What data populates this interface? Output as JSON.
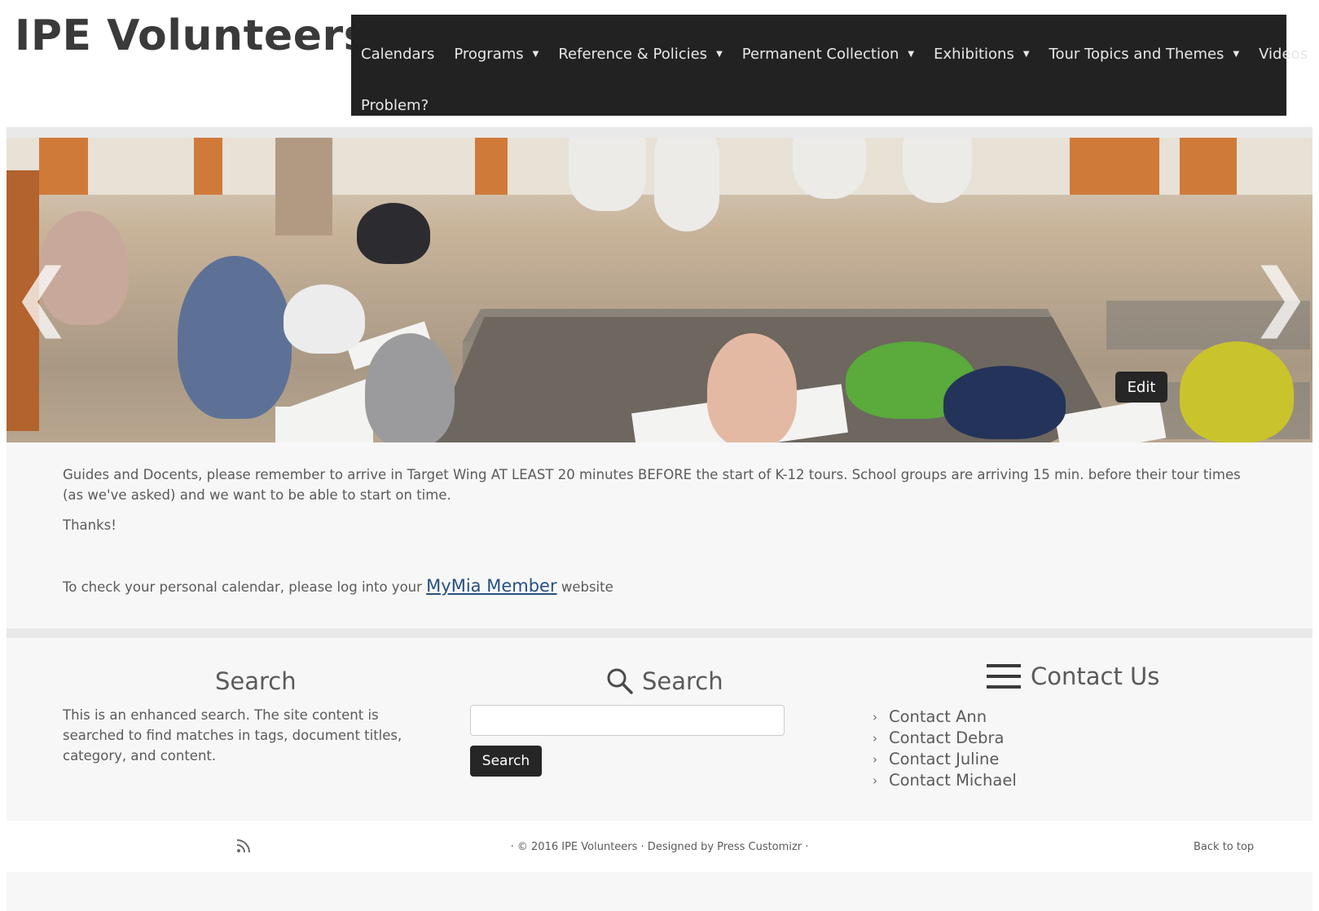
{
  "header": {
    "site_title": "IPE Volunteers",
    "nav": [
      {
        "label": "Calendars",
        "dropdown": false
      },
      {
        "label": "Programs",
        "dropdown": true
      },
      {
        "label": "Reference & Policies",
        "dropdown": true
      },
      {
        "label": "Permanent Collection",
        "dropdown": true
      },
      {
        "label": "Exhibitions",
        "dropdown": true
      },
      {
        "label": "Tour Topics and Themes",
        "dropdown": true
      },
      {
        "label": "Videos",
        "dropdown": false
      },
      {
        "label": "Problem?",
        "dropdown": false
      }
    ]
  },
  "hero": {
    "prev_arrow": "❮",
    "next_arrow": "❯",
    "edit_label": "Edit"
  },
  "content": {
    "paragraph1": "Guides and Docents, please remember to arrive in Target Wing AT LEAST 20 minutes BEFORE the start of K-12 tours. School groups are arriving 15 min. before their tour times (as we've asked) and we want to be able to start on time.",
    "paragraph2": "Thanks!",
    "paragraph3_before": "To check your personal calendar, please log into your ",
    "paragraph3_link": "MyMia Member",
    "paragraph3_after": " website"
  },
  "widgets": {
    "search_info": {
      "title": "Search",
      "text": "This is an enhanced search. The site content is searched to find matches in tags, document titles, category, and content."
    },
    "search": {
      "title": "Search",
      "icon": "search-icon",
      "input_value": "",
      "button_label": "Search"
    },
    "contact": {
      "title": "Contact Us",
      "icon": "menu-icon",
      "items": [
        "Contact Ann",
        "Contact Debra",
        "Contact Juline",
        "Contact Michael"
      ]
    }
  },
  "footer": {
    "rss_icon": "rss-icon",
    "copyright": "· © 2016 IPE Volunteers · Designed by Press Customizr ·",
    "back_to_top": "Back to top"
  },
  "colors": {
    "navbar_bg": "#222222",
    "link": "#27517f",
    "button_bg": "#262626"
  }
}
